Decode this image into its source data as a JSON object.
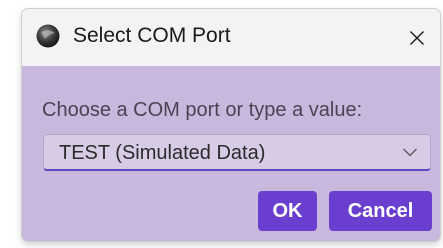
{
  "window": {
    "title": "Select COM Port"
  },
  "dialog": {
    "prompt": "Choose a COM port or type a value:",
    "port_select": {
      "selected_value": "TEST (Simulated Data)"
    },
    "buttons": {
      "ok_label": "OK",
      "cancel_label": "Cancel"
    }
  },
  "icons": {
    "app": "app-logo-icon",
    "close": "close-icon",
    "dropdown": "chevron-down-icon"
  },
  "colors": {
    "titlebar": "#f3f3f3",
    "client_background": "#c9b8de",
    "combo_background": "#d7cbe6",
    "combo_focus_underline": "#5b49c4",
    "button_background": "#6a3fcf",
    "button_text": "#ffffff"
  }
}
